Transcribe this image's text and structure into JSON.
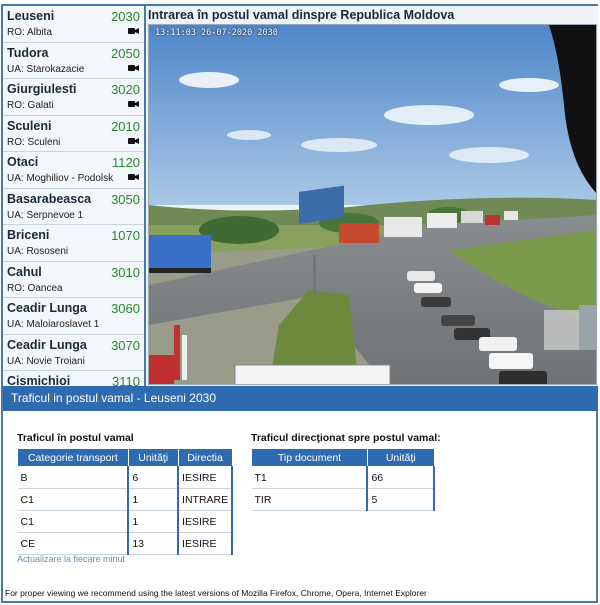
{
  "posts": [
    {
      "name": "Leuseni",
      "code": "2030",
      "country": "RO: Albita",
      "camera": true
    },
    {
      "name": "Tudora",
      "code": "2050",
      "country": "UA: Starokazacie",
      "camera": true
    },
    {
      "name": "Giurgiulesti",
      "code": "3020",
      "country": "RO: Galati",
      "camera": true
    },
    {
      "name": "Sculeni",
      "code": "2010",
      "country": "RO: Sculeni",
      "camera": true
    },
    {
      "name": "Otaci",
      "code": "1120",
      "country": "UA: Moghiliov - Podolsk",
      "camera": true
    },
    {
      "name": "Basarabeasca",
      "code": "3050",
      "country": "UA: Serpnevoe 1",
      "camera": false
    },
    {
      "name": "Briceni",
      "code": "1070",
      "country": "UA: Rososeni",
      "camera": false
    },
    {
      "name": "Cahul",
      "code": "3010",
      "country": "RO: Oancea",
      "camera": false
    },
    {
      "name": "Ceadir Lunga",
      "code": "3060",
      "country": "UA: Maloiaroslavet 1",
      "camera": false
    },
    {
      "name": "Ceadir Lunga",
      "code": "3070",
      "country": "UA: Novie Troiani",
      "camera": false
    },
    {
      "name": "Cismichioi",
      "code": "3110",
      "country": "",
      "camera": false
    }
  ],
  "camera": {
    "title": "Intrarea în postul vamal dinspre Republica Moldova",
    "timestamp": "13:11:03 26-07-2020 2030"
  },
  "traffic_bar_title": "Traficul in postul vamal - Leuseni 2030",
  "traffic_in": {
    "title": "Traficul în postul vamal",
    "headers": [
      "Categorie transport",
      "Unităţi",
      "Directia"
    ],
    "rows": [
      [
        "B",
        "6",
        "IESIRE"
      ],
      [
        "C1",
        "1",
        "INTRARE"
      ],
      [
        "C1",
        "1",
        "IESIRE"
      ],
      [
        "CE",
        "13",
        "IESIRE"
      ]
    ]
  },
  "traffic_directed": {
    "title": "Traficul direcţionat spre postul vamal:",
    "headers": [
      "Tip document",
      "Unităţi"
    ],
    "rows": [
      [
        "T1",
        "66"
      ],
      [
        "TIR",
        "5"
      ]
    ]
  },
  "update_note": "Actualizare la fiecare minut",
  "footer_note": "For proper viewing we recommend using the latest versions of Mozilla Firefox, Chrome, Opera, Internet Explorer",
  "colors": {
    "accent": "#2f6bb0",
    "code_green": "#2a8a2a",
    "border": "#4a78a8"
  }
}
